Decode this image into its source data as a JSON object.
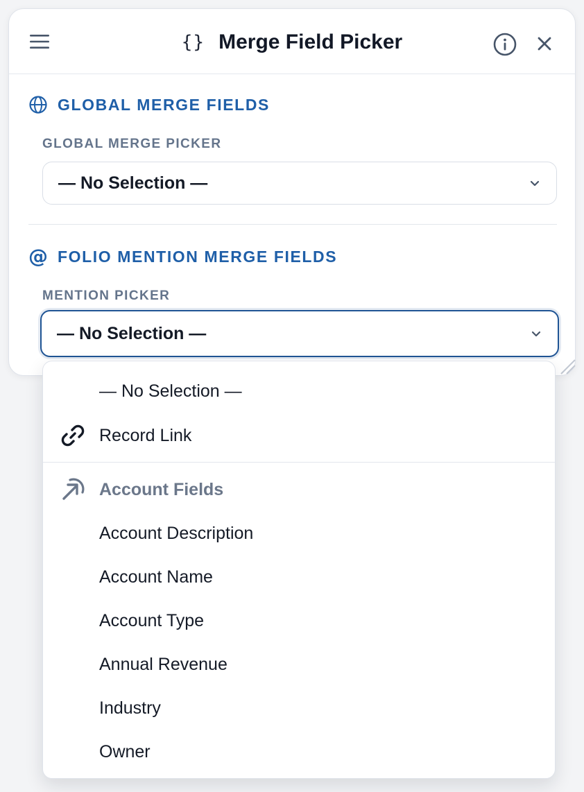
{
  "header": {
    "title": "Merge Field Picker"
  },
  "icons": {
    "menu": "hamburger-menu-icon",
    "braces": "{}",
    "info": "info-icon",
    "close": "close-icon",
    "globe": "globe-icon",
    "at": "@",
    "link": "link-icon",
    "arrow": "arrow-up-right-icon",
    "chevron": "chevron-down-icon"
  },
  "sections": {
    "global": {
      "heading": "GLOBAL MERGE FIELDS",
      "label": "GLOBAL MERGE PICKER",
      "selected": "— No Selection —"
    },
    "mention": {
      "heading": "FOLIO MENTION MERGE FIELDS",
      "label": "MENTION PICKER",
      "selected": "— No Selection —"
    }
  },
  "dropdown": {
    "no_selection": "— No Selection —",
    "record_link": "Record Link",
    "group_label": "Account Fields",
    "items": [
      "Account Description",
      "Account Name",
      "Account Type",
      "Annual Revenue",
      "Industry",
      "Owner"
    ]
  },
  "colors": {
    "accent": "#1f5fa8",
    "focus_border": "#1f5494",
    "muted_label": "#64748b",
    "text": "#141a26"
  }
}
